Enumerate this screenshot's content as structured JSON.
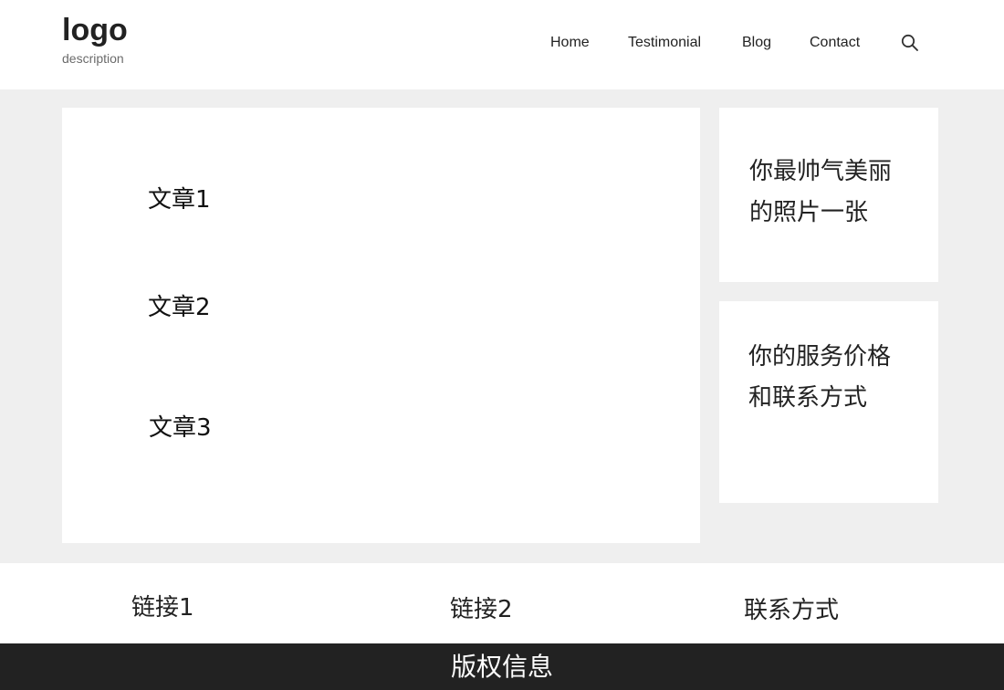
{
  "header": {
    "logo": "logo",
    "description": "description",
    "nav": {
      "home": "Home",
      "testimonial": "Testimonial",
      "blog": "Blog",
      "contact": "Contact"
    }
  },
  "main": {
    "articles": [
      "文章1",
      "文章2",
      "文章3"
    ]
  },
  "sidebar": {
    "photo_card": "你最帅气美丽的照片一张",
    "service_card": "你的服务价格和联系方式"
  },
  "footer": {
    "links": [
      "链接1",
      "链接2",
      "联系方式"
    ],
    "copyright": "版权信息"
  },
  "colors": {
    "page_background": "#efefef",
    "card_background": "#ffffff",
    "copyright_background": "#222222"
  },
  "icons": {
    "search": "search-icon"
  }
}
